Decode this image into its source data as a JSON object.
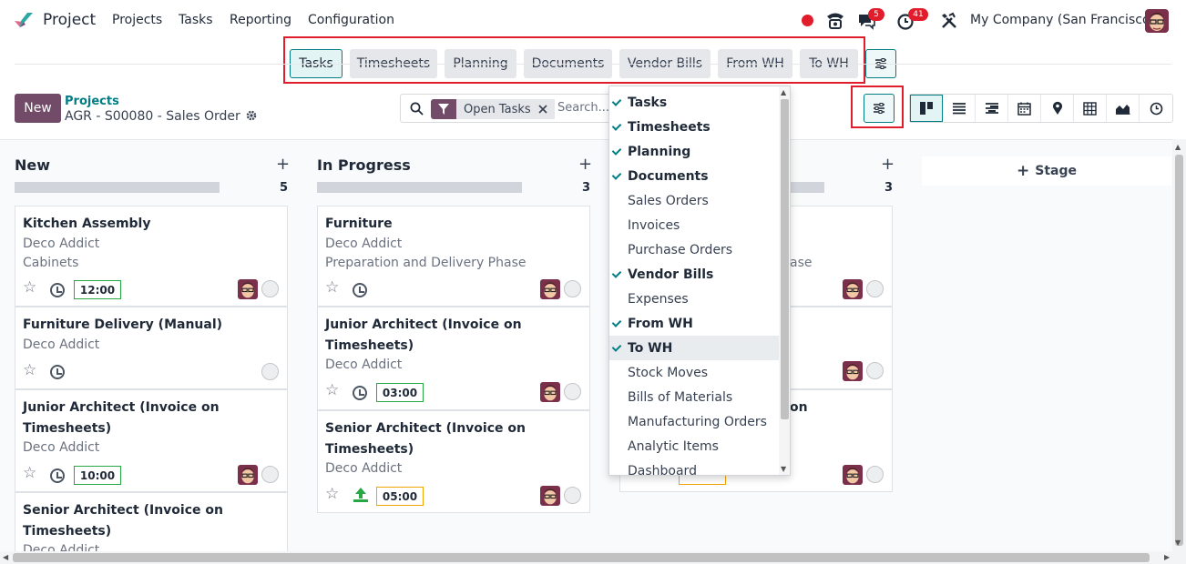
{
  "nav": {
    "app_name": "Project",
    "menu": [
      "Projects",
      "Tasks",
      "Reporting",
      "Configuration"
    ],
    "messages_badge": "5",
    "activities_badge": "41",
    "company": "My Company (San Francisco)"
  },
  "smart_buttons": [
    "Tasks",
    "Timesheets",
    "Planning",
    "Documents",
    "Vendor Bills",
    "From WH",
    "To WH"
  ],
  "control": {
    "new_label": "New",
    "breadcrumb_parent": "Projects",
    "breadcrumb_current": "AGR - S00080 - Sales Order"
  },
  "search": {
    "facet": "Open Tasks",
    "placeholder": "Search..."
  },
  "colors": {
    "brand": "#714b67",
    "accent": "#017e84",
    "highlight": "#e11d2b"
  },
  "columns": [
    {
      "title": "New",
      "count": "5",
      "cards": [
        {
          "title": "Kitchen Assembly",
          "customer": "Deco Addict",
          "subtitle": "Cabinets",
          "time": "12:00"
        },
        {
          "title": "Furniture Delivery (Manual)",
          "customer": "Deco Addict"
        },
        {
          "title": "Junior Architect (Invoice on Timesheets)",
          "customer": "Deco Addict",
          "time": "10:00"
        },
        {
          "title": "Senior Architect (Invoice on Timesheets)",
          "customer": "Deco Addict"
        }
      ]
    },
    {
      "title": "In Progress",
      "count": "3",
      "cards": [
        {
          "title": "Furniture",
          "customer": "Deco Addict",
          "subtitle": "Preparation and Delivery Phase"
        },
        {
          "title": "Junior Architect (Invoice on Timesheets)",
          "customer": "Deco Addict",
          "time": "03:00"
        },
        {
          "title": "Senior Architect (Invoice on Timesheets)",
          "customer": "Deco Addict",
          "time": "05:00"
        }
      ]
    },
    {
      "count": "3",
      "partial_subtitle": "ase",
      "partial_title": "on"
    }
  ],
  "stage_button": "Stage",
  "dropdown": {
    "items": [
      {
        "label": "Tasks",
        "checked": true
      },
      {
        "label": "Timesheets",
        "checked": true
      },
      {
        "label": "Planning",
        "checked": true
      },
      {
        "label": "Documents",
        "checked": true
      },
      {
        "label": "Sales Orders",
        "checked": false
      },
      {
        "label": "Invoices",
        "checked": false
      },
      {
        "label": "Purchase Orders",
        "checked": false
      },
      {
        "label": "Vendor Bills",
        "checked": true
      },
      {
        "label": "Expenses",
        "checked": false
      },
      {
        "label": "From WH",
        "checked": true
      },
      {
        "label": "To WH",
        "checked": true
      },
      {
        "label": "Stock Moves",
        "checked": false
      },
      {
        "label": "Bills of Materials",
        "checked": false
      },
      {
        "label": "Manufacturing Orders",
        "checked": false
      },
      {
        "label": "Analytic Items",
        "checked": false
      },
      {
        "label": "Dashboard",
        "checked": false
      }
    ]
  }
}
